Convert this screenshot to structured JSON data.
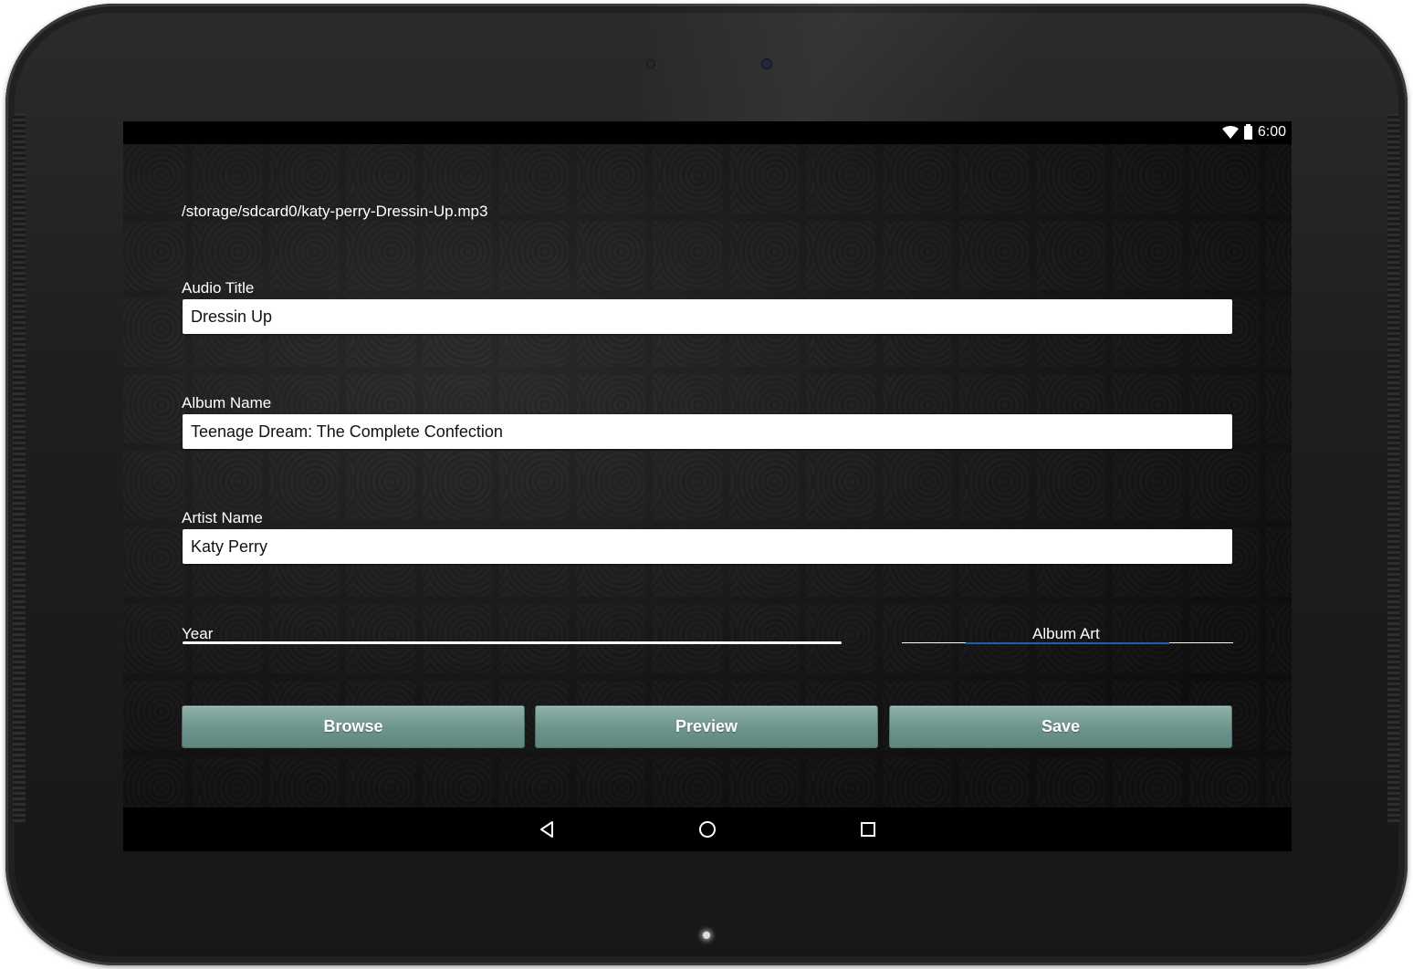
{
  "status_bar": {
    "time": "6:00",
    "icons": [
      "wifi-icon",
      "battery-icon"
    ]
  },
  "file_path": "/storage/sdcard0/katy-perry-Dressin-Up.mp3",
  "fields": {
    "audio_title": {
      "label": "Audio Title",
      "value": "Dressin Up"
    },
    "album_name": {
      "label": "Album Name",
      "value": "Teenage Dream: The Complete Confection"
    },
    "artist_name": {
      "label": "Artist Name",
      "value": "Katy Perry"
    },
    "year": {
      "label": "Year",
      "value": ""
    },
    "album_art": {
      "label": "Album Art"
    }
  },
  "buttons": {
    "browse": "Browse",
    "preview": "Preview",
    "save": "Save"
  },
  "nav_bar": {
    "icons": [
      "back-icon",
      "home-icon",
      "recent-apps-icon"
    ]
  },
  "colors": {
    "button": "#6c948c",
    "accent": "#1f5fae"
  }
}
